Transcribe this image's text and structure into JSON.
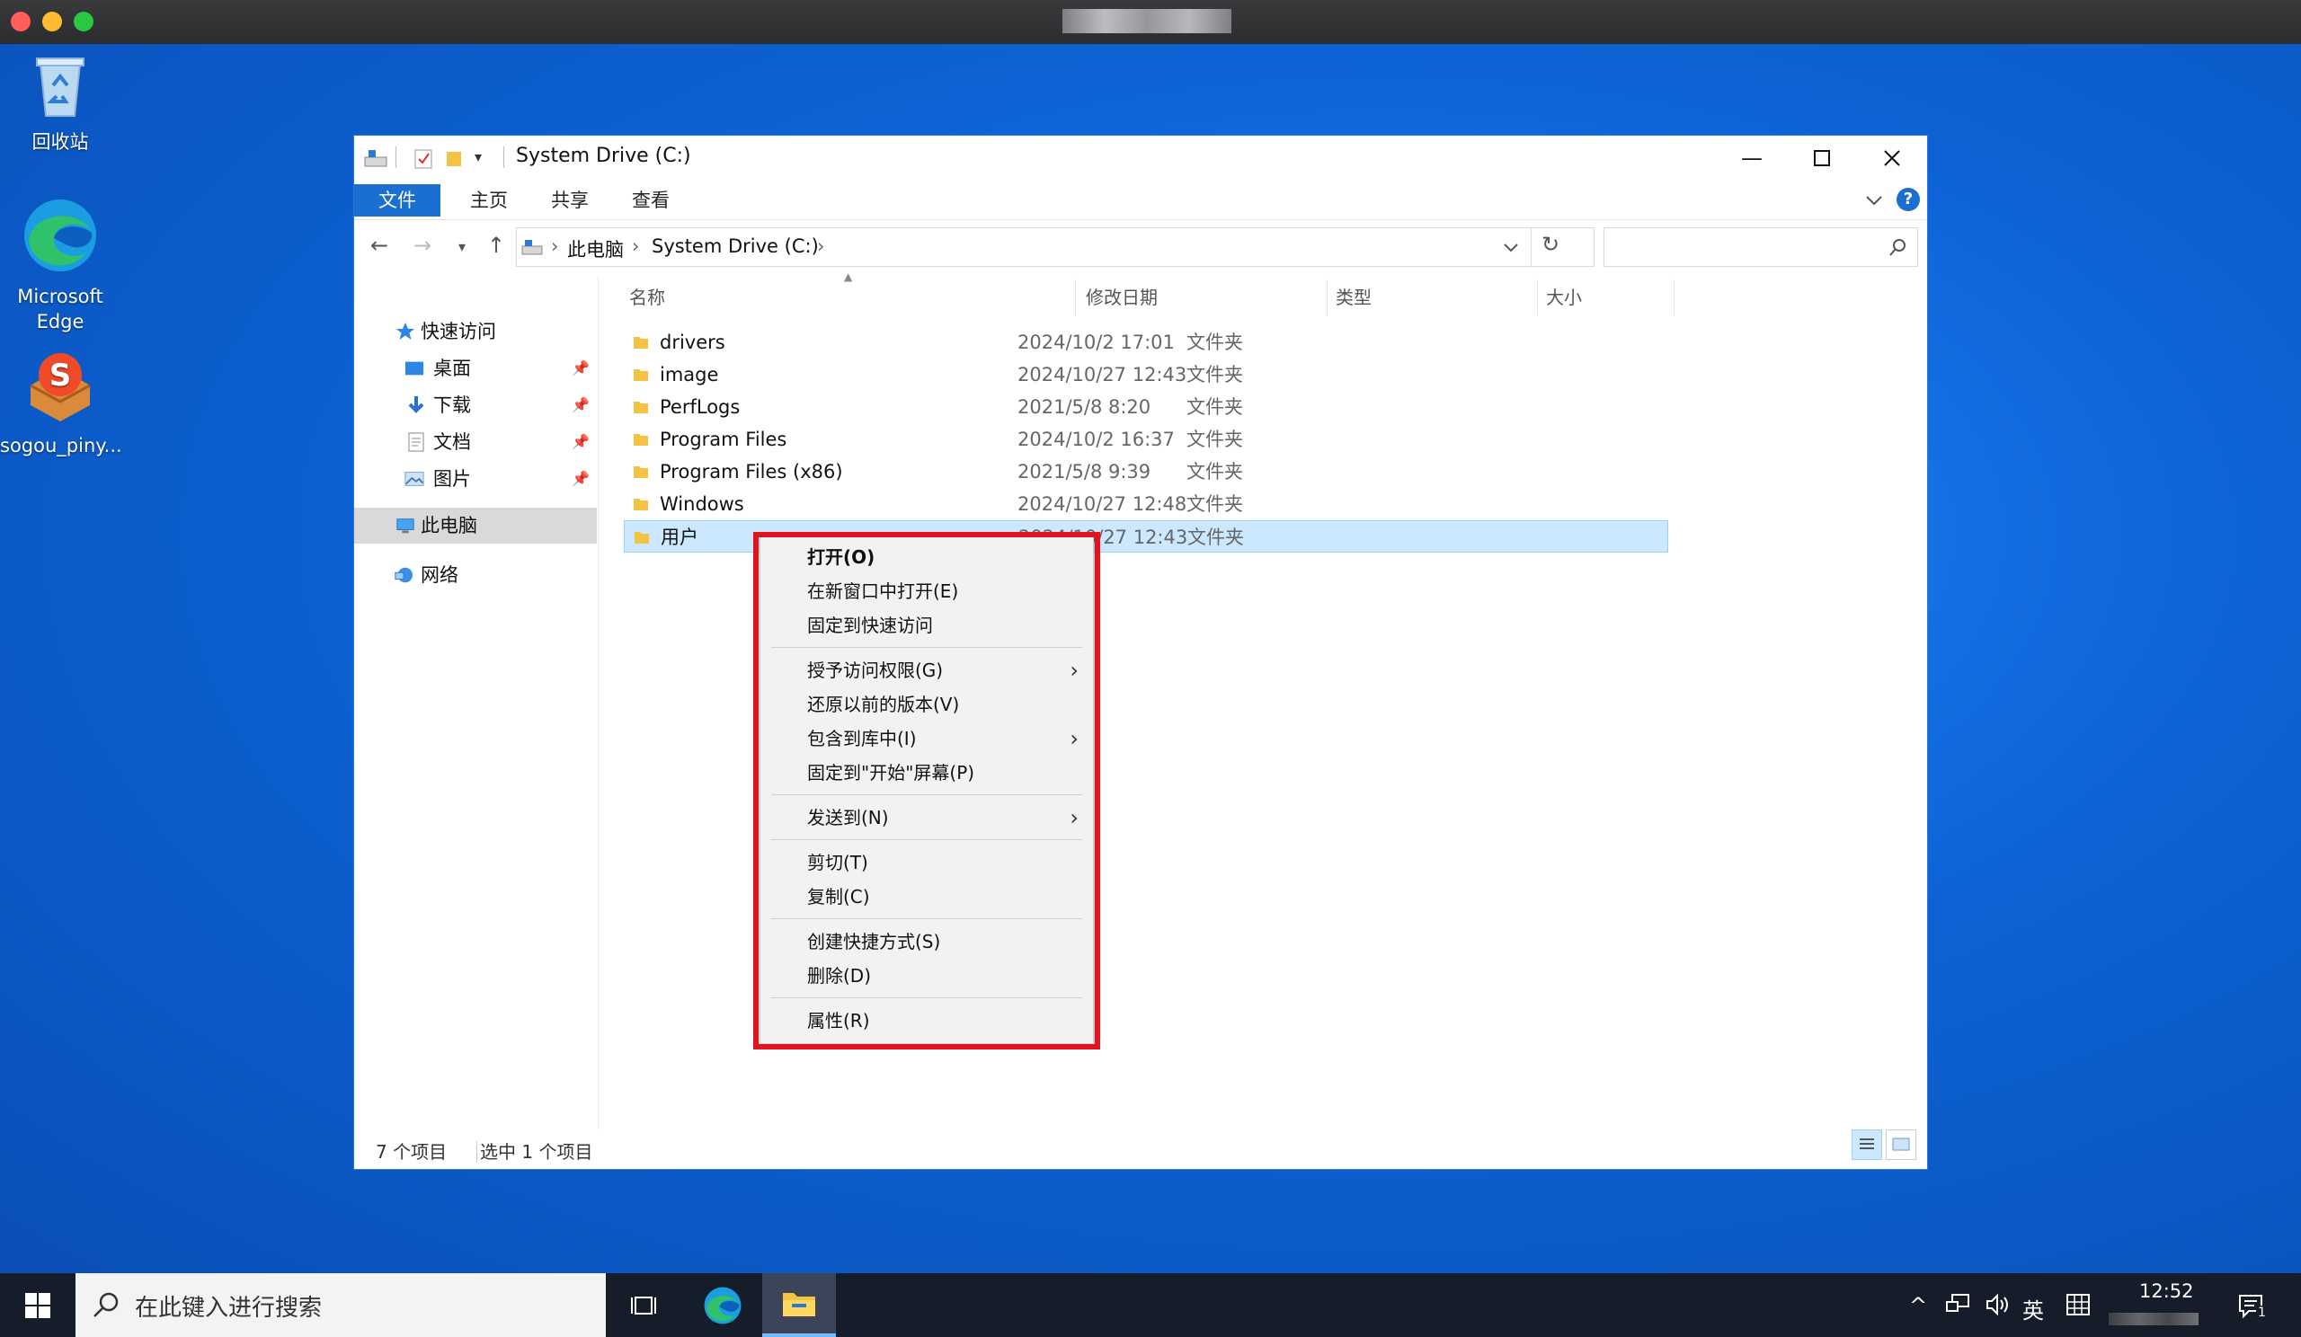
{
  "desktop": {
    "icons": [
      {
        "label": "回收站"
      },
      {
        "label": "Microsoft Edge"
      },
      {
        "label": "sogou_piny..."
      }
    ]
  },
  "window": {
    "title": "System Drive (C:)",
    "ribbon_tabs": [
      "文件",
      "主页",
      "共享",
      "查看"
    ],
    "breadcrumb": [
      "此电脑",
      "System Drive (C:)"
    ],
    "search_placeholder": "",
    "nav": {
      "quick_access": "快速访问",
      "items": [
        "桌面",
        "下载",
        "文档",
        "图片"
      ],
      "this_pc": "此电脑",
      "network": "网络"
    },
    "columns": [
      "名称",
      "修改日期",
      "类型",
      "大小"
    ],
    "files": [
      {
        "name": "drivers",
        "date": "2024/10/2 17:01",
        "type": "文件夹"
      },
      {
        "name": "image",
        "date": "2024/10/27 12:43",
        "type": "文件夹"
      },
      {
        "name": "PerfLogs",
        "date": "2021/5/8 8:20",
        "type": "文件夹"
      },
      {
        "name": "Program Files",
        "date": "2024/10/2 16:37",
        "type": "文件夹"
      },
      {
        "name": "Program Files (x86)",
        "date": "2021/5/8 9:39",
        "type": "文件夹"
      },
      {
        "name": "Windows",
        "date": "2024/10/27 12:48",
        "type": "文件夹"
      },
      {
        "name": "用户",
        "date": "2024/10/27 12:43",
        "type": "文件夹"
      }
    ],
    "status": {
      "count": "7 个项目",
      "selected": "选中 1 个项目"
    }
  },
  "context_menu": {
    "items": [
      "打开(O)",
      "在新窗口中打开(E)",
      "固定到快速访问",
      "授予访问权限(G)",
      "还原以前的版本(V)",
      "包含到库中(I)",
      "固定到\"开始\"屏幕(P)",
      "发送到(N)",
      "剪切(T)",
      "复制(C)",
      "创建快捷方式(S)",
      "删除(D)",
      "属性(R)"
    ]
  },
  "taskbar": {
    "search_placeholder": "在此键入进行搜索",
    "ime": "英",
    "clock": "12:52",
    "notification_count": "1"
  },
  "colors": {
    "accent": "#1a6fd1",
    "highlight": "#e0141e",
    "selection": "#cce8ff"
  }
}
